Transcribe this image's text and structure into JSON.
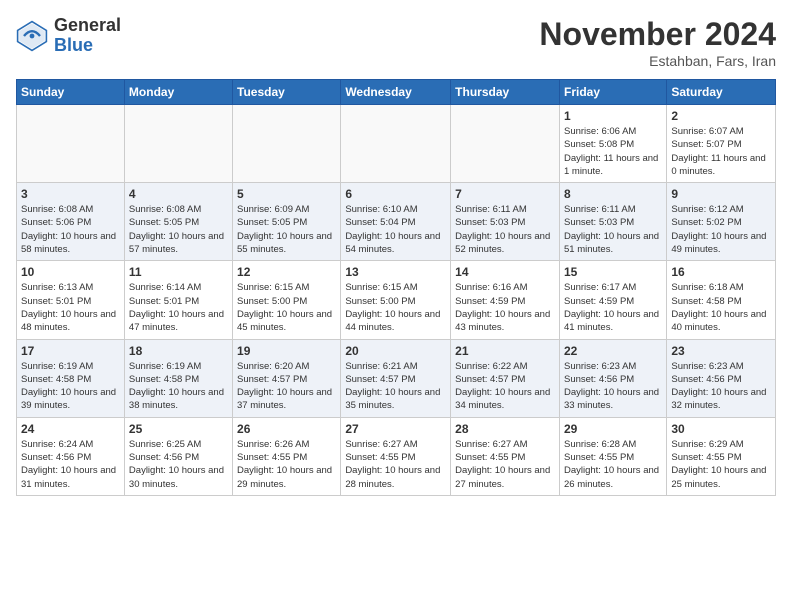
{
  "header": {
    "logo_general": "General",
    "logo_blue": "Blue",
    "month_title": "November 2024",
    "location": "Estahban, Fars, Iran"
  },
  "weekdays": [
    "Sunday",
    "Monday",
    "Tuesday",
    "Wednesday",
    "Thursday",
    "Friday",
    "Saturday"
  ],
  "weeks": [
    [
      {
        "day": "",
        "info": ""
      },
      {
        "day": "",
        "info": ""
      },
      {
        "day": "",
        "info": ""
      },
      {
        "day": "",
        "info": ""
      },
      {
        "day": "",
        "info": ""
      },
      {
        "day": "1",
        "info": "Sunrise: 6:06 AM\nSunset: 5:08 PM\nDaylight: 11 hours and 1 minute."
      },
      {
        "day": "2",
        "info": "Sunrise: 6:07 AM\nSunset: 5:07 PM\nDaylight: 11 hours and 0 minutes."
      }
    ],
    [
      {
        "day": "3",
        "info": "Sunrise: 6:08 AM\nSunset: 5:06 PM\nDaylight: 10 hours and 58 minutes."
      },
      {
        "day": "4",
        "info": "Sunrise: 6:08 AM\nSunset: 5:05 PM\nDaylight: 10 hours and 57 minutes."
      },
      {
        "day": "5",
        "info": "Sunrise: 6:09 AM\nSunset: 5:05 PM\nDaylight: 10 hours and 55 minutes."
      },
      {
        "day": "6",
        "info": "Sunrise: 6:10 AM\nSunset: 5:04 PM\nDaylight: 10 hours and 54 minutes."
      },
      {
        "day": "7",
        "info": "Sunrise: 6:11 AM\nSunset: 5:03 PM\nDaylight: 10 hours and 52 minutes."
      },
      {
        "day": "8",
        "info": "Sunrise: 6:11 AM\nSunset: 5:03 PM\nDaylight: 10 hours and 51 minutes."
      },
      {
        "day": "9",
        "info": "Sunrise: 6:12 AM\nSunset: 5:02 PM\nDaylight: 10 hours and 49 minutes."
      }
    ],
    [
      {
        "day": "10",
        "info": "Sunrise: 6:13 AM\nSunset: 5:01 PM\nDaylight: 10 hours and 48 minutes."
      },
      {
        "day": "11",
        "info": "Sunrise: 6:14 AM\nSunset: 5:01 PM\nDaylight: 10 hours and 47 minutes."
      },
      {
        "day": "12",
        "info": "Sunrise: 6:15 AM\nSunset: 5:00 PM\nDaylight: 10 hours and 45 minutes."
      },
      {
        "day": "13",
        "info": "Sunrise: 6:15 AM\nSunset: 5:00 PM\nDaylight: 10 hours and 44 minutes."
      },
      {
        "day": "14",
        "info": "Sunrise: 6:16 AM\nSunset: 4:59 PM\nDaylight: 10 hours and 43 minutes."
      },
      {
        "day": "15",
        "info": "Sunrise: 6:17 AM\nSunset: 4:59 PM\nDaylight: 10 hours and 41 minutes."
      },
      {
        "day": "16",
        "info": "Sunrise: 6:18 AM\nSunset: 4:58 PM\nDaylight: 10 hours and 40 minutes."
      }
    ],
    [
      {
        "day": "17",
        "info": "Sunrise: 6:19 AM\nSunset: 4:58 PM\nDaylight: 10 hours and 39 minutes."
      },
      {
        "day": "18",
        "info": "Sunrise: 6:19 AM\nSunset: 4:58 PM\nDaylight: 10 hours and 38 minutes."
      },
      {
        "day": "19",
        "info": "Sunrise: 6:20 AM\nSunset: 4:57 PM\nDaylight: 10 hours and 37 minutes."
      },
      {
        "day": "20",
        "info": "Sunrise: 6:21 AM\nSunset: 4:57 PM\nDaylight: 10 hours and 35 minutes."
      },
      {
        "day": "21",
        "info": "Sunrise: 6:22 AM\nSunset: 4:57 PM\nDaylight: 10 hours and 34 minutes."
      },
      {
        "day": "22",
        "info": "Sunrise: 6:23 AM\nSunset: 4:56 PM\nDaylight: 10 hours and 33 minutes."
      },
      {
        "day": "23",
        "info": "Sunrise: 6:23 AM\nSunset: 4:56 PM\nDaylight: 10 hours and 32 minutes."
      }
    ],
    [
      {
        "day": "24",
        "info": "Sunrise: 6:24 AM\nSunset: 4:56 PM\nDaylight: 10 hours and 31 minutes."
      },
      {
        "day": "25",
        "info": "Sunrise: 6:25 AM\nSunset: 4:56 PM\nDaylight: 10 hours and 30 minutes."
      },
      {
        "day": "26",
        "info": "Sunrise: 6:26 AM\nSunset: 4:55 PM\nDaylight: 10 hours and 29 minutes."
      },
      {
        "day": "27",
        "info": "Sunrise: 6:27 AM\nSunset: 4:55 PM\nDaylight: 10 hours and 28 minutes."
      },
      {
        "day": "28",
        "info": "Sunrise: 6:27 AM\nSunset: 4:55 PM\nDaylight: 10 hours and 27 minutes."
      },
      {
        "day": "29",
        "info": "Sunrise: 6:28 AM\nSunset: 4:55 PM\nDaylight: 10 hours and 26 minutes."
      },
      {
        "day": "30",
        "info": "Sunrise: 6:29 AM\nSunset: 4:55 PM\nDaylight: 10 hours and 25 minutes."
      }
    ]
  ]
}
